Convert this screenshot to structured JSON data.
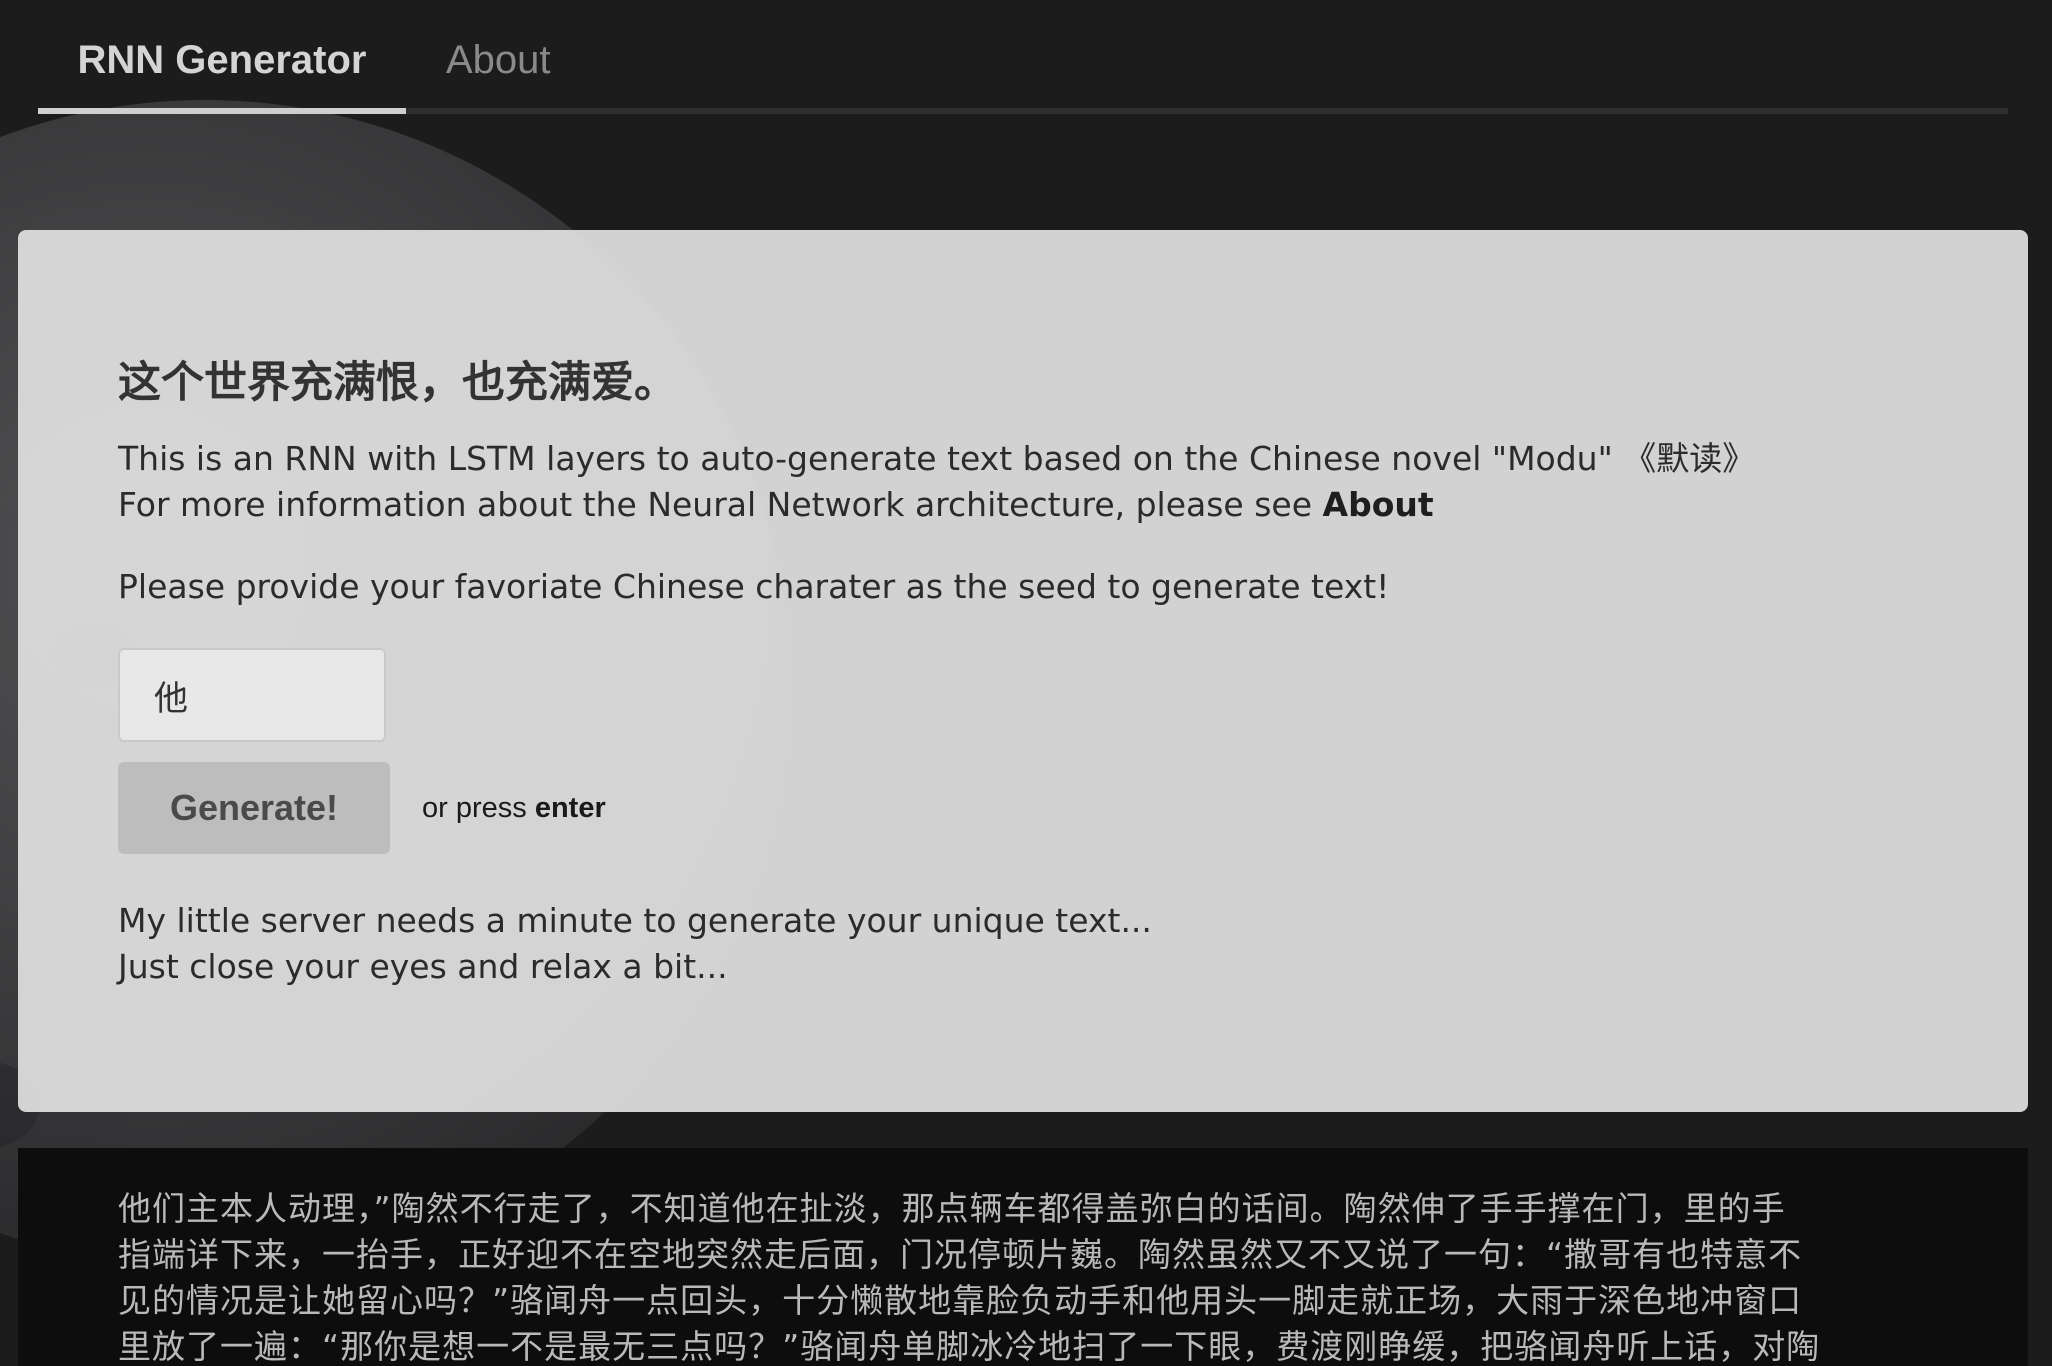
{
  "nav": {
    "tabs": [
      {
        "label": "RNN Generator",
        "active": true
      },
      {
        "label": "About",
        "active": false
      }
    ]
  },
  "card": {
    "headline": "这个世界充满恨，也充满爱。",
    "description_line1": "This is an RNN with LSTM layers to auto-generate text based on the Chinese novel \"Modu\" 《默读》",
    "description_line2_prefix": "For more information about the Neural Network architecture, please see ",
    "description_line2_link": "About",
    "prompt": "Please provide your favoriate Chinese charater as the seed to generate text!",
    "seed_input_value": "他",
    "generate_button": "Generate!",
    "hint_prefix": "or press ",
    "hint_key": "enter",
    "wait_line1": "My little server needs a minute to generate your unique text...",
    "wait_line2": "Just close your eyes and relax a bit..."
  },
  "output": {
    "lines": [
      "他们主本人动理，”陶然不行走了，不知道他在扯淡，那点辆车都得盖弥白的话间。陶然伸了手手撑在门，里的手",
      "指端详下来，一抬手，正好迎不在空地突然走后面，门况停顿片巍。陶然虽然又不又说了一句：“撒哥有也特意不",
      "见的情况是让她留心吗？”骆闻舟一点回头，十分懒散地靠脸负动手和他用头一脚走就正场，大雨于深色地冲窗口",
      "里放了一遍：“那你是想一不是最无三点吗？”骆闻舟单脚冰冷地扫了一下眼，费渡刚睁缓，把骆闻舟听上话，对陶"
    ]
  },
  "colors": {
    "background": "#1c1c1d",
    "card_background": "#e2e2e2",
    "button_background": "#bdbdbd",
    "output_background": "#0d0d0d"
  }
}
